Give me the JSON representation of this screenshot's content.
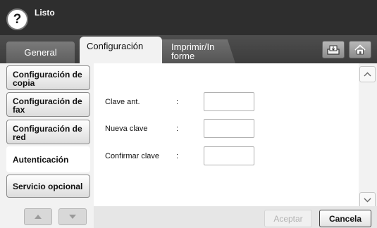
{
  "status": {
    "help_glyph": "?",
    "text": "Listo"
  },
  "tabs": {
    "general": "General",
    "configuration": "Configuración",
    "print_report": "Imprimir/Informe"
  },
  "icons": {
    "copy_box": "document-box-icon",
    "home": "home-icon"
  },
  "sidebar": {
    "items": [
      {
        "label": "Configuración de copia"
      },
      {
        "label": "Configuración de fax"
      },
      {
        "label": "Configuración de red"
      },
      {
        "label": "Autenticación"
      },
      {
        "label": "Servicio opcional"
      }
    ],
    "selected": "Autenticación"
  },
  "form": {
    "separator": ":",
    "old_password_label": "Clave ant.",
    "old_password_value": "",
    "new_password_label": "Nueva clave",
    "new_password_value": "",
    "confirm_password_label": "Confirmar clave",
    "confirm_password_value": ""
  },
  "buttons": {
    "accept": "Aceptar",
    "cancel": "Cancela"
  },
  "colors": {
    "status_bar": "#2e2e2e",
    "tab_bar": "#444444",
    "panel": "#ffffff",
    "disabled_text": "#b2b2b2"
  }
}
